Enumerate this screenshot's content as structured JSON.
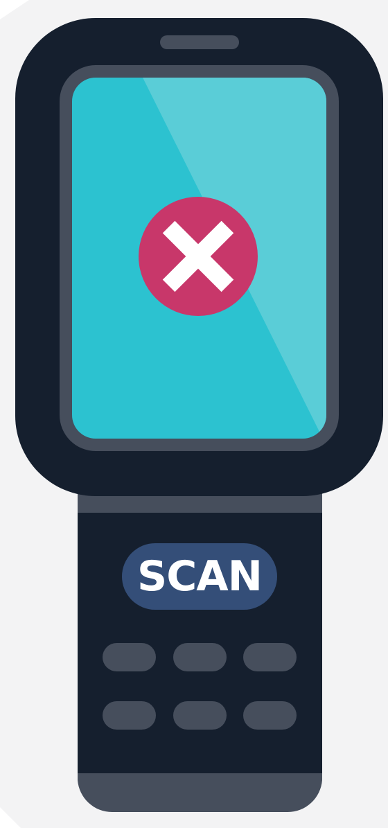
{
  "device": {
    "scan_button_label": "SCAN",
    "status_icon": "error-x-icon",
    "keypad_key_count": 6
  },
  "colors": {
    "background": "#f3f3f4",
    "body": "#151f2e",
    "bezel": "#464e5c",
    "screen": "#2cc2d0",
    "screen_glare": "#5acdd7",
    "error_badge": "#c8376a",
    "scan_button": "#344e78"
  }
}
